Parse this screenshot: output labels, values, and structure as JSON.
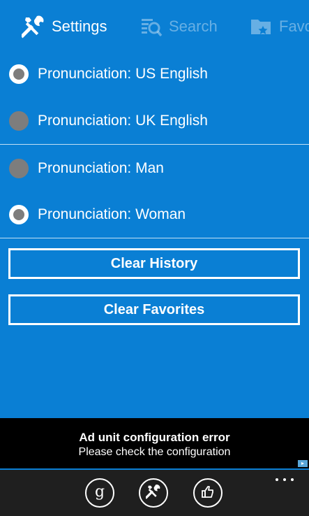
{
  "pivot": {
    "items": [
      {
        "label": "Settings",
        "icon": "tools-icon",
        "active": true
      },
      {
        "label": "Search",
        "icon": "search-list-icon",
        "active": false
      },
      {
        "label": "Favo",
        "icon": "folder-star-icon",
        "active": false
      }
    ]
  },
  "pronunciation": {
    "accent_group": [
      {
        "label": "Pronunciation: US English",
        "selected": true
      },
      {
        "label": "Pronunciation: UK English",
        "selected": false
      }
    ],
    "voice_group": [
      {
        "label": "Pronunciation: Man",
        "selected": false
      },
      {
        "label": "Pronunciation: Woman",
        "selected": true
      }
    ]
  },
  "actions": {
    "clear_history": "Clear History",
    "clear_favorites": "Clear Favorites"
  },
  "ad": {
    "title": "Ad unit configuration error",
    "subtitle": "Please check the configuration"
  },
  "appbar": {
    "buttons": [
      {
        "icon": "google-icon",
        "glyph": "g"
      },
      {
        "icon": "tools-icon"
      },
      {
        "icon": "thumbs-up-icon"
      }
    ],
    "more": "more-icon"
  },
  "colors": {
    "background": "#0a7fd4",
    "radio_off": "#7d7d7d",
    "ad_background": "#000000",
    "appbar_background": "#1f1f1f"
  }
}
